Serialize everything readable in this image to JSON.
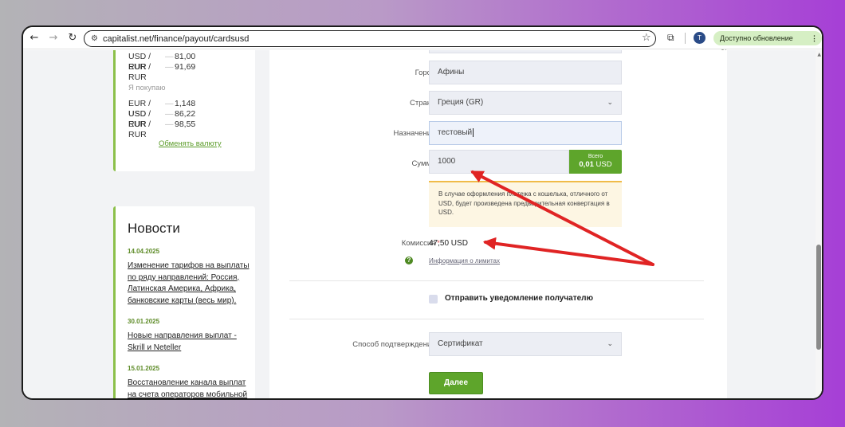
{
  "browser": {
    "url": "capitalist.net/finance/payout/cardsusd",
    "profile_initial": "T",
    "update_label": "Доступно обновление Chrome",
    "icons": {
      "back": "back-arrow-icon",
      "forward": "forward-arrow-icon",
      "reload": "reload-icon",
      "site_info": "tune-icon",
      "bookmark": "star-icon",
      "extensions": "puzzle-icon",
      "menu": "kebab-menu-icon"
    }
  },
  "rates": {
    "sell_rows": [
      {
        "pair": "USD / RUR",
        "value": "81,00"
      },
      {
        "pair": "EUR / RUR",
        "value": "91,69"
      }
    ],
    "buy_heading": "Я покупаю",
    "buy_rows": [
      {
        "pair": "EUR / USD",
        "value": "1,148"
      },
      {
        "pair": "USD / RUR",
        "value": "86,22"
      },
      {
        "pair": "EUR / RUR",
        "value": "98,55"
      }
    ],
    "exchange_link": "Обменять валюту"
  },
  "news": {
    "heading": "Новости",
    "items": [
      {
        "date": "14.04.2025",
        "title": "Изменение тарифов на выплаты по ряду направлений: Россия, Латинская Америка, Африка, банковские карты (весь мир)."
      },
      {
        "date": "30.01.2025",
        "title": "Новые направления выплат - Skrill и Neteller"
      },
      {
        "date": "15.01.2025",
        "title": "Восстановление канала выплат на счета операторов мобильной связи РФ"
      }
    ]
  },
  "form": {
    "required_mark": "*",
    "city": {
      "label": "Город",
      "value": "Афины"
    },
    "country": {
      "label": "Страна",
      "value": "Греция (GR)"
    },
    "purpose": {
      "label": "Назначение",
      "value": "тестовый"
    },
    "amount": {
      "label": "Сумма",
      "value": "1000"
    },
    "total": {
      "caption": "Всего",
      "amount": "0,01",
      "currency": "USD"
    },
    "notice": "В случае оформления платежа с кошелька, отличного от USD, будет произведена предварительная конвертация в USD.",
    "commission": {
      "label": "Комиссия",
      "value": "47,50 USD"
    },
    "limits_link": "Информация о лимитах",
    "notify_label": "Отправить уведомление получателю",
    "confirm": {
      "label": "Способ подтверждения",
      "value": "Сертификат"
    },
    "next_button": "Далее"
  },
  "colors": {
    "accent_green": "#5ea52b",
    "annotation_red": "#e02424",
    "notice_border": "#f0bb48",
    "update_badge": "#d6efc4"
  }
}
